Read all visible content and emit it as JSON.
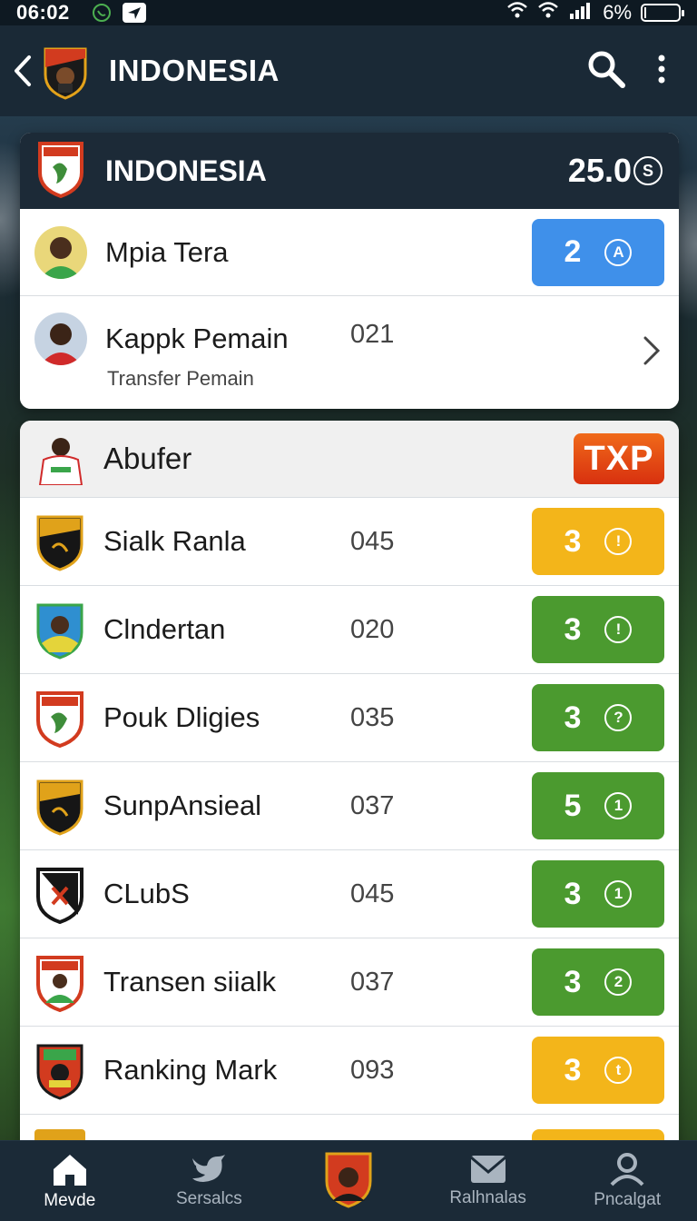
{
  "status_bar": {
    "time": "06:02",
    "battery": "6%"
  },
  "app_bar": {
    "title": "INDONESIA"
  },
  "header_card": {
    "title": "INDONESIA",
    "amount": "25.0",
    "amount_icon": "S"
  },
  "top_rows": [
    {
      "name": "Mpia Tera",
      "value": "2",
      "badge_icon": "A",
      "color": "#3f90ea"
    },
    {
      "name": "Kappk Pemain",
      "code": "021",
      "subtitle": "Transfer Pemain"
    }
  ],
  "list_card": {
    "title": "Abufer",
    "tag": "TXP"
  },
  "list_rows": [
    {
      "name": "Sialk Ranla",
      "code": "045",
      "value": "3",
      "badge_icon": "!",
      "color": "#f3b51a"
    },
    {
      "name": "Clndertan",
      "code": "020",
      "value": "3",
      "badge_icon": "!",
      "color": "#4b9a2f"
    },
    {
      "name": "Pouk Dligies",
      "code": "035",
      "value": "3",
      "badge_icon": "?",
      "color": "#4b9a2f"
    },
    {
      "name": "SunpAnsieal",
      "code": "037",
      "value": "5",
      "badge_icon": "1",
      "color": "#4b9a2f"
    },
    {
      "name": "CLubS",
      "code": "045",
      "value": "3",
      "badge_icon": "1",
      "color": "#4b9a2f"
    },
    {
      "name": "Transen siialk",
      "code": "037",
      "value": "3",
      "badge_icon": "2",
      "color": "#4b9a2f"
    },
    {
      "name": "Ranking Mark",
      "code": "093",
      "value": "3",
      "badge_icon": "t",
      "color": "#f3b51a"
    }
  ],
  "bottom_nav": [
    {
      "label": "Mevde",
      "icon": "home-icon"
    },
    {
      "label": "Sersalcs",
      "icon": "bird-icon"
    },
    {
      "label": "",
      "icon": "team-crest-icon"
    },
    {
      "label": "Ralhnalas",
      "icon": "mail-icon"
    },
    {
      "label": "Pncalgat",
      "icon": "profile-icon"
    }
  ]
}
